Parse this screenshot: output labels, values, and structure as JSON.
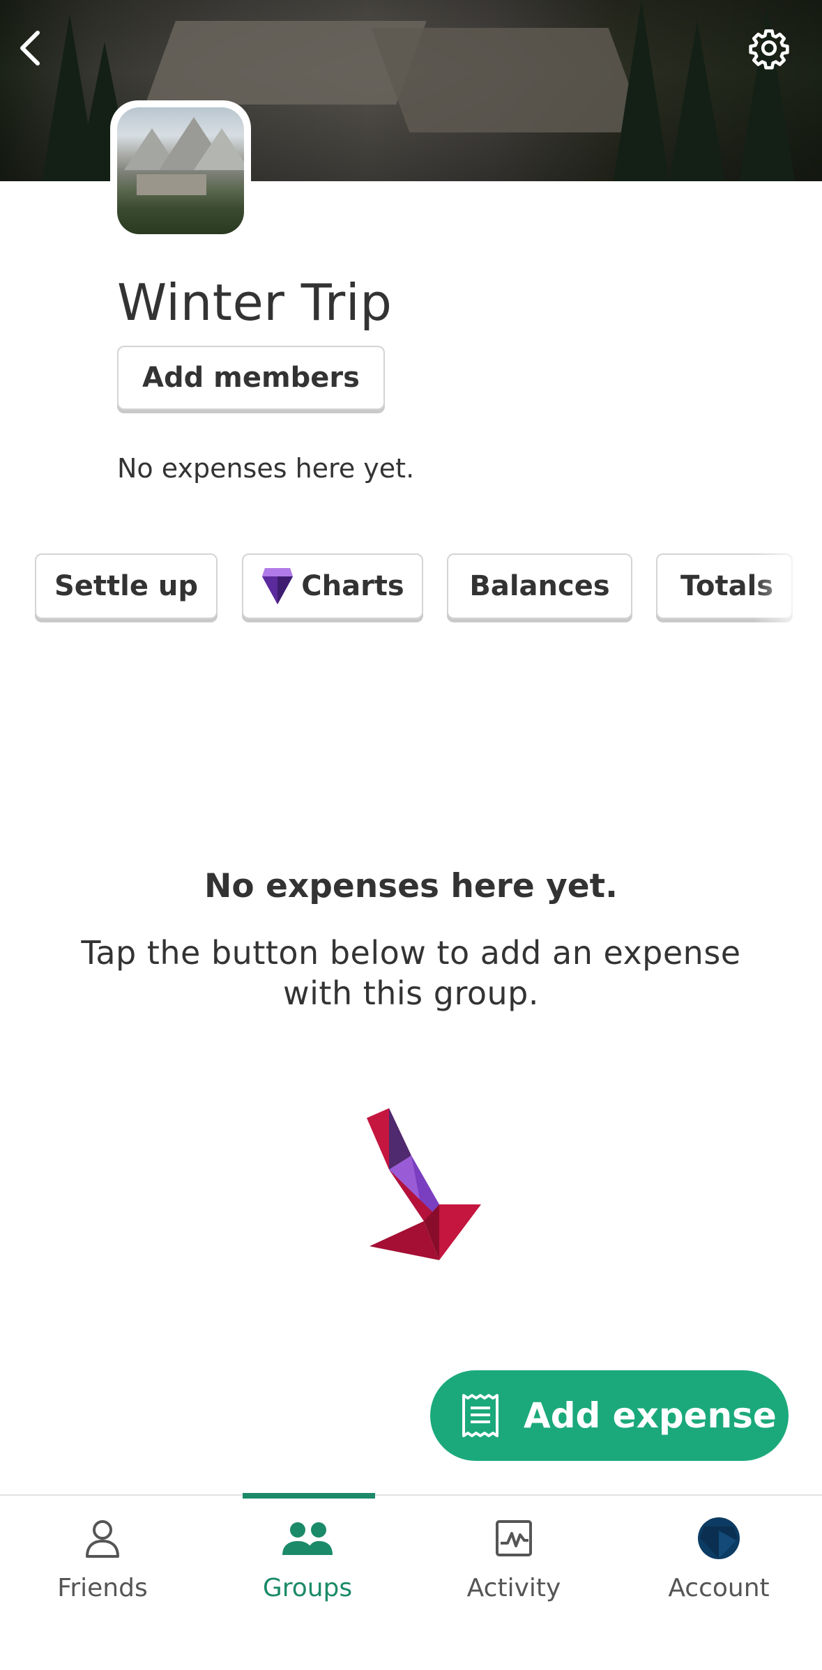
{
  "header": {
    "back_icon": "chevron-left-icon",
    "settings_icon": "gear-icon"
  },
  "group": {
    "name": "Winter Trip",
    "add_members_label": "Add members",
    "summary": "No expenses here yet."
  },
  "actions": {
    "buttons": [
      {
        "label": "Settle up"
      },
      {
        "label": "Charts",
        "icon": "diamond-icon"
      },
      {
        "label": "Balances"
      },
      {
        "label": "Totals"
      }
    ]
  },
  "empty_state": {
    "heading": "No expenses here yet.",
    "body": "Tap the button below to add an expense with this group."
  },
  "fab": {
    "label": "Add expense",
    "icon": "receipt-icon",
    "color": "#1ba97b"
  },
  "nav": {
    "items": [
      {
        "label": "Friends",
        "icon": "person-icon",
        "active": false
      },
      {
        "label": "Groups",
        "icon": "people-icon",
        "active": true
      },
      {
        "label": "Activity",
        "icon": "activity-icon",
        "active": false
      },
      {
        "label": "Account",
        "icon": "avatar",
        "active": false
      }
    ],
    "active_color": "#1b8a68"
  }
}
